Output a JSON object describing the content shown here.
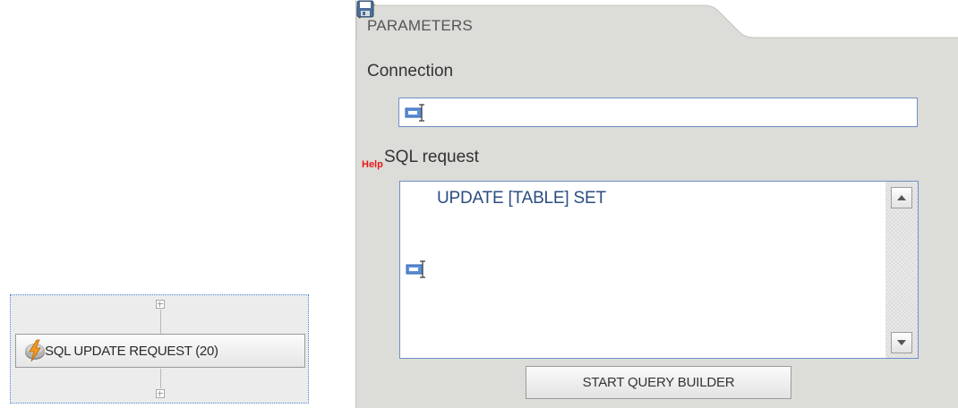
{
  "workflow_node": {
    "label": "SQL UPDATE REQUEST (20)",
    "icon": "sql-lightning-icon"
  },
  "panel": {
    "title": "PARAMETERS",
    "toolbar": {
      "wand_icon": "magic-wand-icon",
      "save_icon": "save-icon"
    },
    "connection": {
      "label": "Connection",
      "value": "",
      "icon": "text-caret-icon"
    },
    "sql": {
      "help": "Help",
      "label": "SQL request",
      "value": "UPDATE [TABLE] SET",
      "icon": "text-caret-icon"
    },
    "query_builder_label": "START QUERY BUILDER"
  },
  "colors": {
    "panel_bg": "#dcdcd8",
    "help_red": "#e8191a",
    "sql_text": "#2b4d82",
    "field_border": "#6e90c4",
    "selection_dotted": "#4a86d8"
  }
}
